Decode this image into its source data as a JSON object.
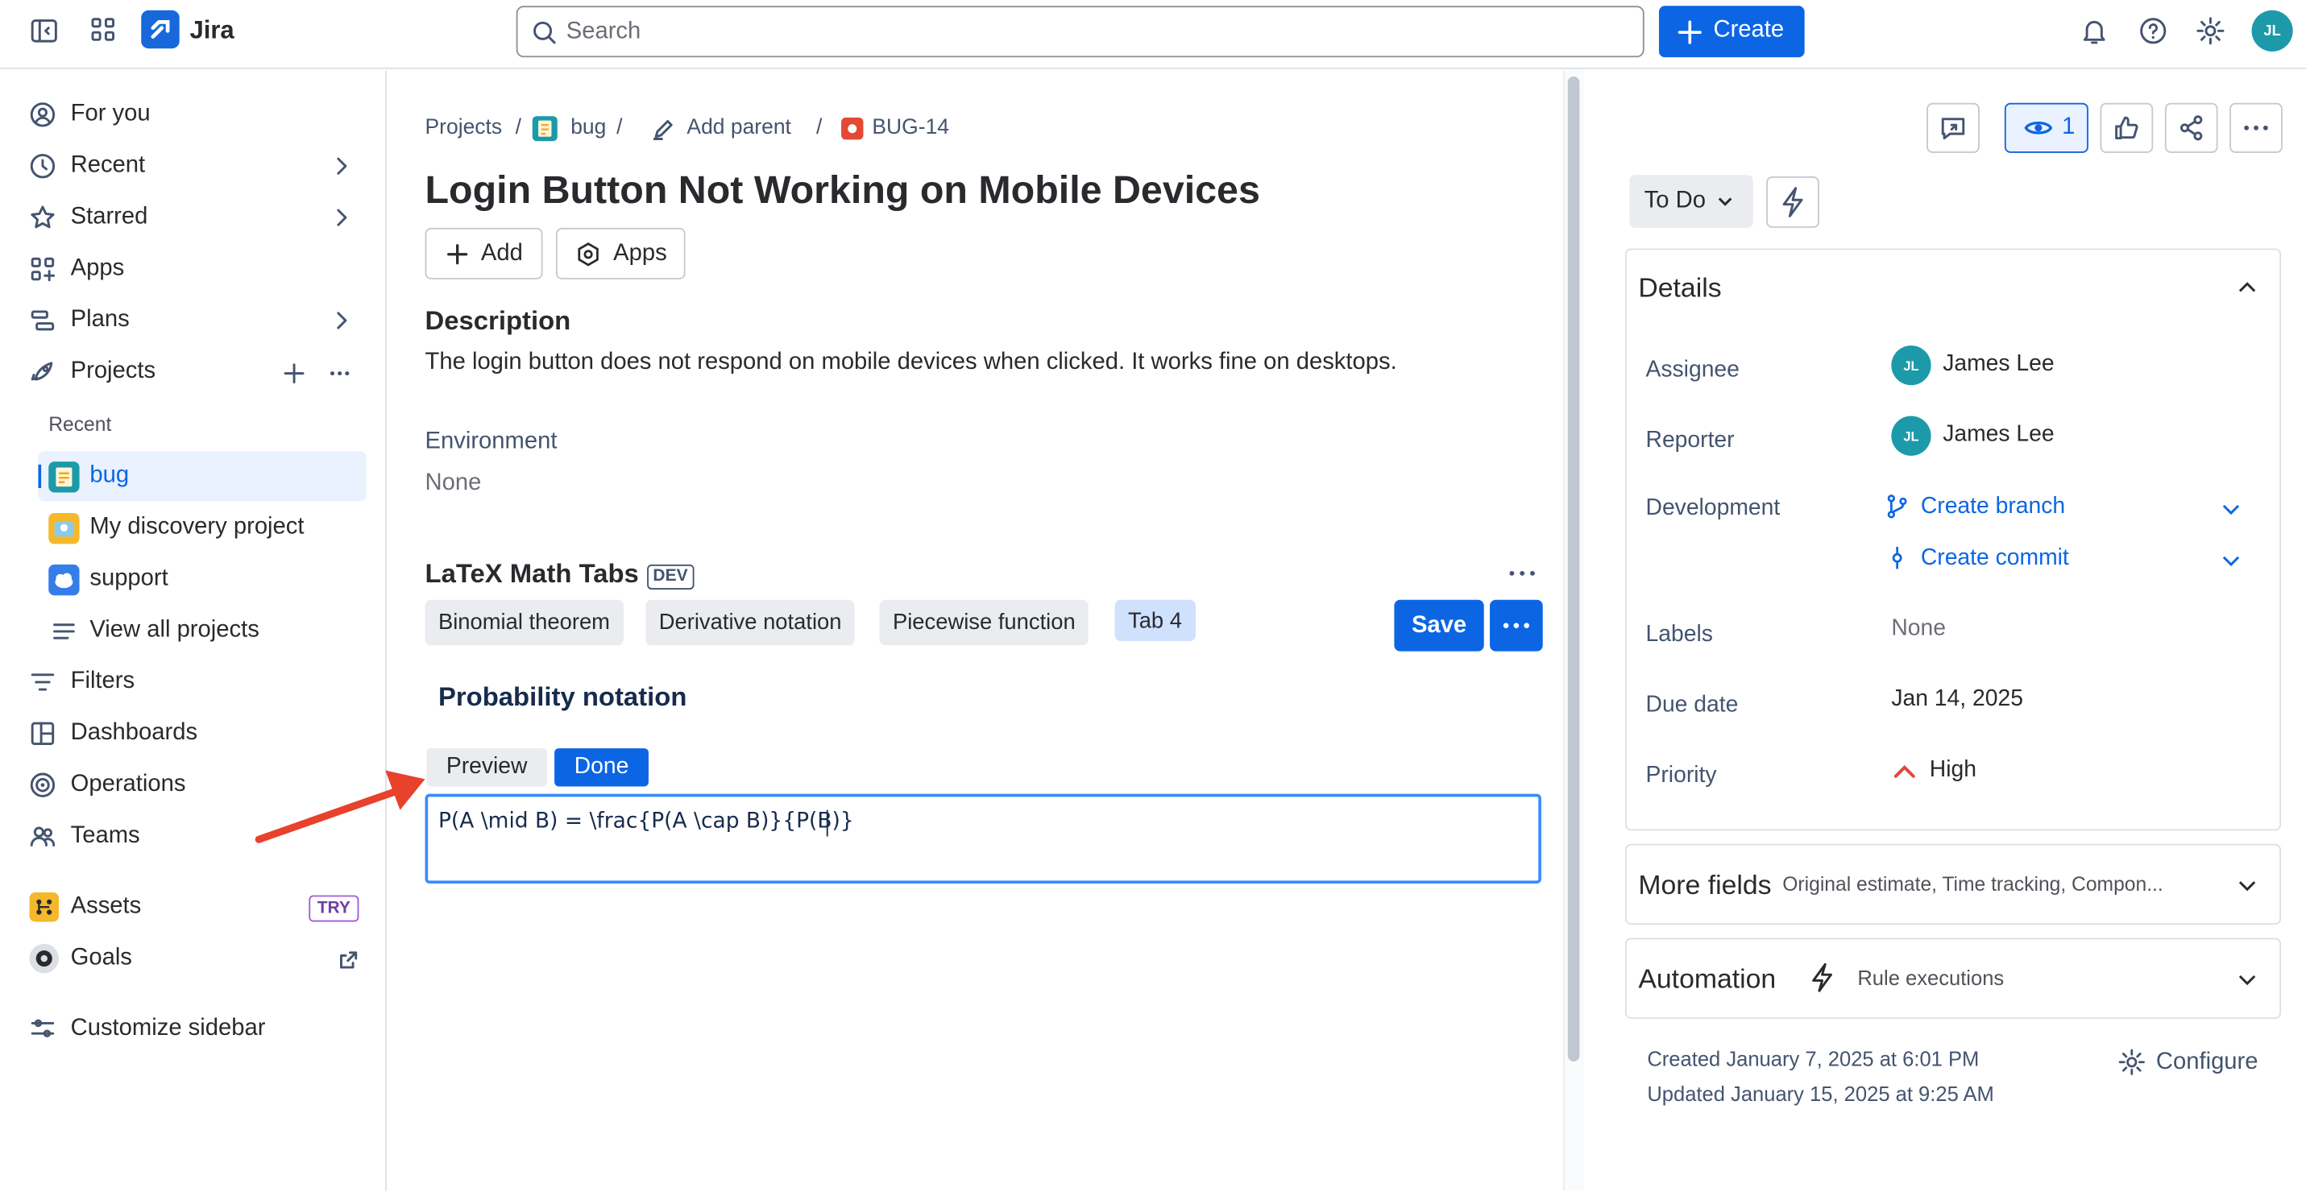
{
  "app": {
    "name": "Jira"
  },
  "search": {
    "placeholder": "Search"
  },
  "header": {
    "create_label": "Create",
    "user_initials": "JL"
  },
  "sidebar": {
    "for_you": "For you",
    "recent": "Recent",
    "starred": "Starred",
    "apps": "Apps",
    "plans": "Plans",
    "projects": "Projects",
    "recent_heading": "Recent",
    "projects_list": [
      "bug",
      "My discovery project",
      "support"
    ],
    "view_all": "View all projects",
    "filters": "Filters",
    "dashboards": "Dashboards",
    "operations": "Operations",
    "teams": "Teams",
    "assets": "Assets",
    "assets_badge": "TRY",
    "goals": "Goals",
    "customize": "Customize sidebar"
  },
  "breadcrumb": {
    "projects": "Projects",
    "project": "bug",
    "add_parent": "Add parent",
    "issue_key": "BUG-14",
    "sep": "/"
  },
  "issue": {
    "title": "Login Button Not Working on Mobile Devices",
    "add_label": "Add",
    "apps_label": "Apps",
    "description_heading": "Description",
    "description": "The login button does not respond on mobile devices when clicked. It works fine on desktops.",
    "environment_heading": "Environment",
    "environment_value": "None"
  },
  "latex": {
    "title": "LaTeX Math Tabs",
    "badge": "DEV",
    "tabs": [
      "Binomial theorem",
      "Derivative notation",
      "Piecewise function",
      "Tab 4"
    ],
    "active_tab": "Tab 4",
    "save_label": "Save",
    "section_title": "Probability notation",
    "preview_label": "Preview",
    "done_label": "Done",
    "editor_value": "P(A \\mid B) = \\frac{P(A \\cap B)}{P(B)}"
  },
  "right_panel": {
    "watchers_count": "1",
    "status": "To Do",
    "details_heading": "Details",
    "assignee_label": "Assignee",
    "assignee": "James Lee",
    "reporter_label": "Reporter",
    "reporter": "James Lee",
    "avatar_initials": "JL",
    "development_label": "Development",
    "create_branch": "Create branch",
    "create_commit": "Create commit",
    "labels_label": "Labels",
    "labels_value": "None",
    "due_date_label": "Due date",
    "due_date": "Jan 14, 2025",
    "priority_label": "Priority",
    "priority": "High",
    "more_fields": "More fields",
    "more_fields_hint": "Original estimate, Time tracking, Compon...",
    "automation": "Automation",
    "rule_executions": "Rule executions",
    "created": "Created January 7, 2025 at 6:01 PM",
    "updated": "Updated January 15, 2025 at 9:25 AM",
    "configure": "Configure"
  },
  "colors": {
    "brand": "#0c66e4",
    "annotation_arrow": "#e8412c",
    "priority_high": "#e2483d"
  }
}
